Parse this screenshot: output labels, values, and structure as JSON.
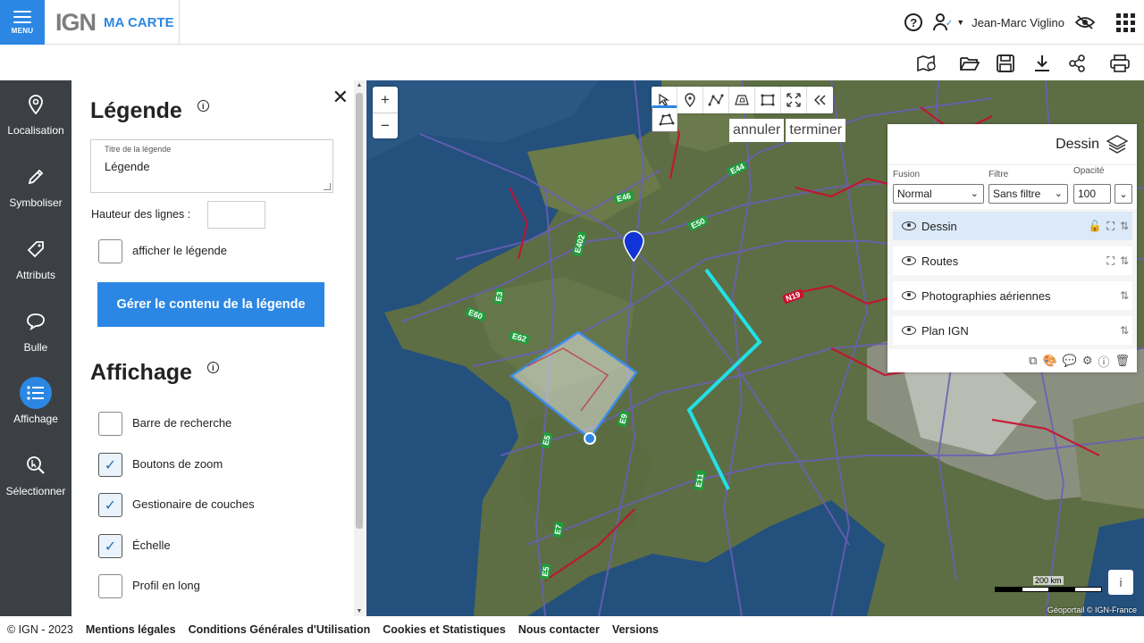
{
  "header": {
    "menu_label": "MENU",
    "logo": "IGN",
    "app_title": "MA CARTE",
    "user_name": "Jean-Marc Viglino"
  },
  "toolbar2": {
    "icons": [
      "map-tools-icon",
      "open-folder-icon",
      "save-icon",
      "download-icon",
      "share-icon",
      "print-icon"
    ]
  },
  "leftnav": {
    "items": [
      {
        "label": "Localisation",
        "icon": "pin-icon"
      },
      {
        "label": "Symboliser",
        "icon": "pencil-icon"
      },
      {
        "label": "Attributs",
        "icon": "tag-icon"
      },
      {
        "label": "Bulle",
        "icon": "speech-bubble-icon"
      },
      {
        "label": "Affichage",
        "icon": "list-icon",
        "active": true
      },
      {
        "label": "Sélectionner",
        "icon": "select-magnifier-icon"
      }
    ]
  },
  "panel": {
    "legend_title": "Légende",
    "legend_field_caption": "Titre de la légende",
    "legend_field_value": "Légende",
    "line_height_label": "Hauteur des lignes :",
    "show_legend_label": "afficher le légende",
    "manage_button": "Gérer le contenu de la légende",
    "display_title": "Affichage",
    "options": [
      {
        "label": "Barre de recherche",
        "checked": false
      },
      {
        "label": "Boutons de zoom",
        "checked": true
      },
      {
        "label": "Gestionaire de couches",
        "checked": true
      },
      {
        "label": "Échelle",
        "checked": true
      },
      {
        "label": "Profil en long",
        "checked": false
      }
    ]
  },
  "map": {
    "zoom_in": "+",
    "zoom_out": "−",
    "draw_actions": {
      "undo": "annuler",
      "finish": "terminer"
    },
    "road_labels": [
      "E44",
      "E46",
      "E50",
      "E402",
      "E3",
      "E60",
      "E62",
      "N19",
      "E9",
      "E5",
      "E11",
      "E7",
      "E5"
    ],
    "scale_label": "200 km",
    "attribution": "Géoportail © IGN-France",
    "info_btn": "i"
  },
  "layers": {
    "title": "Dessin",
    "fusion_label": "Fusion",
    "fusion_value": "Normal",
    "filter_label": "Filtre",
    "filter_value": "Sans filtre",
    "opacity_label": "Opacité",
    "opacity_value": "100",
    "items": [
      {
        "name": "Dessin",
        "active": true
      },
      {
        "name": "Routes",
        "active": false
      },
      {
        "name": "Photographies aériennes",
        "active": false
      },
      {
        "name": "Plan IGN",
        "active": false
      }
    ]
  },
  "footer": {
    "copyright": "© IGN - 2023",
    "links": [
      "Mentions légales",
      "Conditions Générales d'Utilisation",
      "Cookies et Statistiques",
      "Nous contacter",
      "Versions"
    ]
  },
  "colors": {
    "accent": "#2b87e3",
    "nav_bg": "#3c3f44",
    "draw_line": "#22e0e6",
    "road_primary": "#c8102e",
    "road_secondary": "#6a5fb8"
  }
}
